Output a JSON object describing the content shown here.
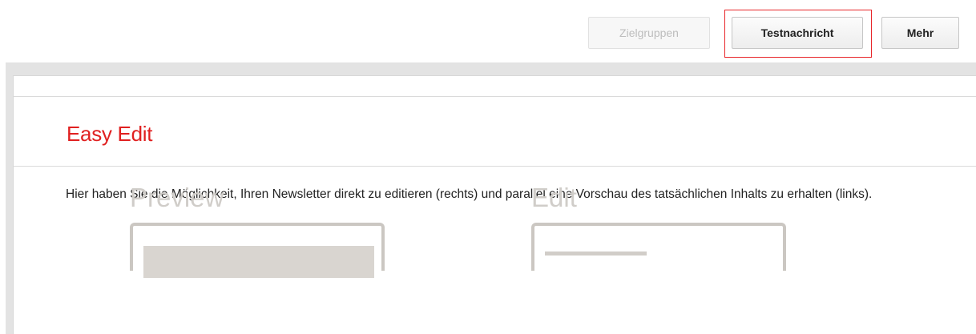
{
  "toolbar": {
    "target_groups_label": "Zielgruppen",
    "test_message_label": "Testnachricht",
    "more_label": "Mehr"
  },
  "section": {
    "title": "Easy Edit",
    "intro": "Hier haben Sie die Möglichkeit, Ihren Newsletter direkt zu editieren (rechts) und parallel eine Vorschau des tatsächlichen Inhalts zu erhalten (links)."
  },
  "illustration": {
    "preview_label": "Preview",
    "edit_label": "Edit"
  },
  "colors": {
    "accent_red": "#e02020",
    "highlight_border": "#e8262a",
    "illustration_grey": "#cbc7c2"
  }
}
